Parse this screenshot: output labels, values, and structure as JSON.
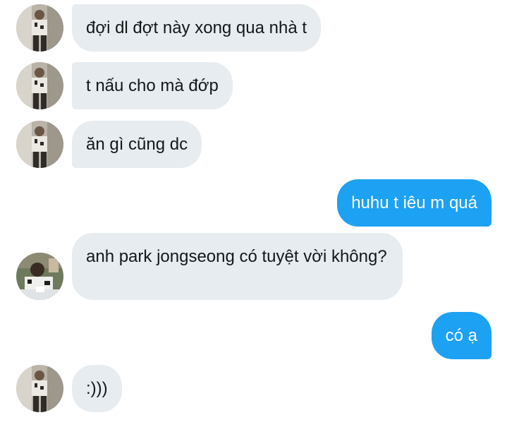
{
  "conversation": {
    "messages": [
      {
        "direction": "incoming",
        "text": "đợi dl đợt này xong qua nhà t"
      },
      {
        "direction": "incoming",
        "text": "t nấu cho mà đớp"
      },
      {
        "direction": "incoming",
        "text": "ăn gì cũng dc"
      },
      {
        "direction": "outgoing",
        "text": "huhu t iêu m quá"
      },
      {
        "direction": "incoming",
        "text": "anh park jongseong có tuyệt vời không?"
      },
      {
        "direction": "outgoing",
        "text": "có ạ"
      },
      {
        "direction": "incoming",
        "text": ":)))"
      }
    ]
  },
  "colors": {
    "incoming_bubble": "#e6ecf0",
    "incoming_text": "#14171a",
    "outgoing_bubble": "#1da1f2",
    "outgoing_text": "#ffffff"
  },
  "icons": {
    "contact_avatar": "profile-photo",
    "contact_avatar_alt": "profile-photo-seated"
  }
}
